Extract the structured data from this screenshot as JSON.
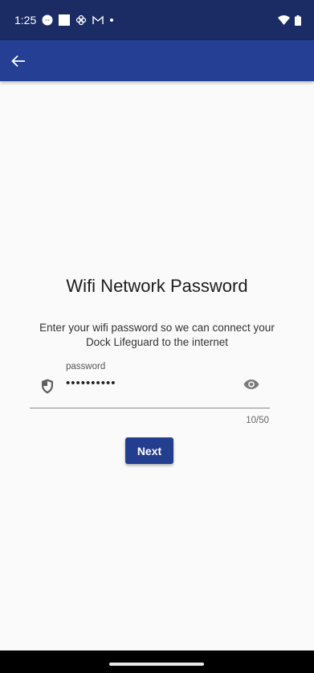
{
  "status_bar": {
    "time": "1:25",
    "icons": [
      "messenger-icon",
      "square-notification-icon",
      "fan-icon",
      "gmail-icon",
      "dot-icon"
    ],
    "right_icons": [
      "wifi-icon",
      "battery-icon"
    ]
  },
  "app_bar": {
    "back_icon": "arrow-left-icon"
  },
  "main": {
    "title": "Wifi Network Password",
    "subtitle": "Enter your wifi password so we can connect your Dock Lifeguard to the internet",
    "password_field": {
      "label": "password",
      "value": "••••••••••",
      "counter": "10/50",
      "leading_icon": "shield-icon",
      "trailing_icon": "eye-icon"
    },
    "next_label": "Next"
  },
  "colors": {
    "status_bar": "#1b2c64",
    "app_bar": "#243f93",
    "button": "#233d8f",
    "background": "#fafafa"
  }
}
